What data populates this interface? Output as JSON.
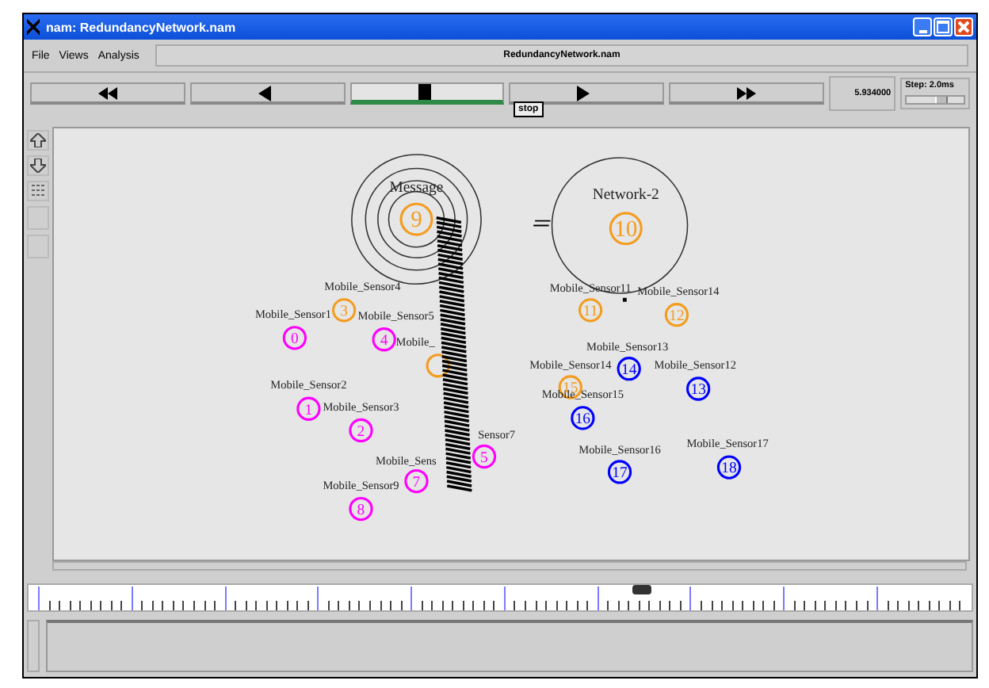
{
  "window": {
    "title": "nam: RedundancyNetwork.nam"
  },
  "menu": [
    {
      "label": "File"
    },
    {
      "label": "Views"
    },
    {
      "label": "Analysis"
    }
  ],
  "file_name": "RedundancyNetwork.nam",
  "controls": [
    {
      "kind": "rewind",
      "selected": false
    },
    {
      "kind": "back",
      "selected": false
    },
    {
      "kind": "stop",
      "selected": true
    },
    {
      "kind": "play",
      "selected": false
    },
    {
      "kind": "forward",
      "selected": false
    }
  ],
  "tooltip": "stop",
  "time": "5.934000",
  "step": "Step: 2.0ms",
  "step_slider": {
    "level": 0.6
  },
  "nodes": [
    {
      "kind": "broadcast",
      "number": "9",
      "label": "Message",
      "color": "#f39c1f"
    },
    {
      "kind": "range",
      "number": "10",
      "label": "Network-2",
      "color": "#f39c1f"
    },
    {
      "kind": "sensor",
      "number": "3",
      "label": "Mobile_Sensor4",
      "color": "#f39c1f"
    },
    {
      "kind": "sensor",
      "number": "0",
      "label": "Mobile_Sensor1",
      "color": "#ff00ff"
    },
    {
      "kind": "sensor",
      "number": "4",
      "label": "Mobile_Sensor5",
      "color": "#ff00ff"
    },
    {
      "kind": "sensor",
      "label": "Mobile_",
      "color": "#f39c1f"
    },
    {
      "kind": "sensor",
      "number": "1",
      "label": "Mobile_Sensor2",
      "color": "#ff00ff"
    },
    {
      "kind": "sensor",
      "number": "2",
      "label": "Mobile_Sensor3",
      "color": "#ff00ff"
    },
    {
      "kind": "sensor",
      "number": "5",
      "label": "Sensor7",
      "color": "#ff00ff"
    },
    {
      "kind": "sensor",
      "number": "7",
      "label": "Mobile_Sens",
      "color": "#ff00ff"
    },
    {
      "kind": "sensor",
      "number": "8",
      "label": "Mobile_Sensor9",
      "color": "#ff00ff"
    },
    {
      "kind": "sensor",
      "number": "11",
      "label": "Mobile_Sensor11",
      "color": "#f39c1f"
    },
    {
      "kind": "sensor",
      "number": "12",
      "label": "Mobile_Sensor14",
      "color": "#f39c1f"
    },
    {
      "kind": "sensor",
      "number": "14",
      "label": "Mobile_Sensor13",
      "color": "#0000ff"
    },
    {
      "kind": "sensor",
      "number": "15",
      "label": "Mobile_Sensor14",
      "color": "#f39c1f"
    },
    {
      "kind": "sensor",
      "number": "13",
      "label": "Mobile_Sensor12",
      "color": "#0000ff"
    },
    {
      "kind": "sensor",
      "number": "16",
      "label": "Mobile_Sensor15",
      "color": "#0000ff"
    },
    {
      "kind": "sensor",
      "number": "17",
      "label": "Mobile_Sensor16",
      "color": "#0000ff"
    },
    {
      "kind": "sensor",
      "number": "18",
      "label": "Mobile_Sensor17",
      "color": "#0000ff"
    }
  ],
  "timeline": {
    "level": 0.65
  }
}
